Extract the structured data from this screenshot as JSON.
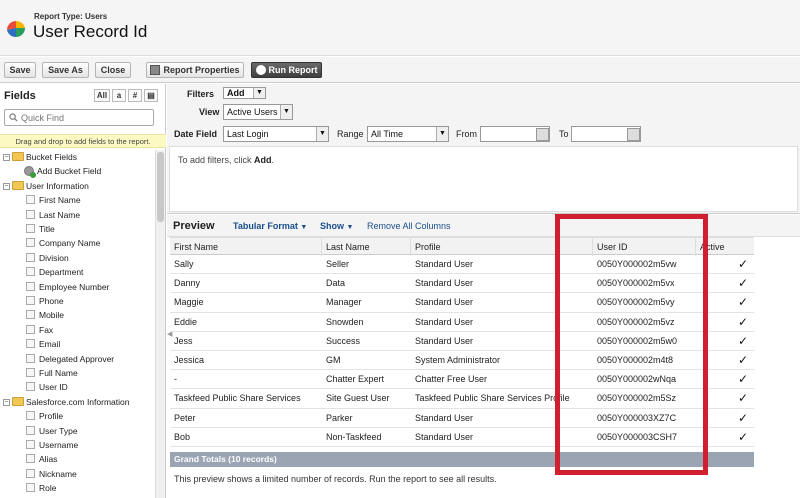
{
  "header": {
    "report_type": "Report Type: Users",
    "title": "User Record Id"
  },
  "toolbar": {
    "save": "Save",
    "save_as": "Save As",
    "close": "Close",
    "properties": "Report Properties",
    "run": "Run Report"
  },
  "fields_panel": {
    "heading": "Fields",
    "type_filters": [
      "All",
      "a",
      "#",
      "▤"
    ],
    "quick_find_placeholder": "Quick Find",
    "drag_note": "Drag and drop to add fields to the report.",
    "tree": [
      {
        "kind": "folder",
        "label": "Bucket Fields"
      },
      {
        "kind": "bucket",
        "label": "Add Bucket Field"
      },
      {
        "kind": "folder",
        "label": "User Information"
      },
      {
        "kind": "field",
        "label": "First Name"
      },
      {
        "kind": "field",
        "label": "Last Name"
      },
      {
        "kind": "field",
        "label": "Title"
      },
      {
        "kind": "field",
        "label": "Company Name"
      },
      {
        "kind": "field",
        "label": "Division"
      },
      {
        "kind": "field",
        "label": "Department"
      },
      {
        "kind": "field",
        "label": "Employee Number"
      },
      {
        "kind": "field",
        "label": "Phone"
      },
      {
        "kind": "field",
        "label": "Mobile"
      },
      {
        "kind": "field",
        "label": "Fax"
      },
      {
        "kind": "field",
        "label": "Email"
      },
      {
        "kind": "field",
        "label": "Delegated Approver"
      },
      {
        "kind": "field",
        "label": "Full Name"
      },
      {
        "kind": "field",
        "label": "User ID"
      },
      {
        "kind": "folder",
        "label": "Salesforce.com Information"
      },
      {
        "kind": "field",
        "label": "Profile"
      },
      {
        "kind": "field",
        "label": "User Type"
      },
      {
        "kind": "field",
        "label": "Username"
      },
      {
        "kind": "field",
        "label": "Alias"
      },
      {
        "kind": "field",
        "label": "Nickname"
      },
      {
        "kind": "field",
        "label": "Role"
      }
    ]
  },
  "filters": {
    "label": "Filters",
    "add": "Add",
    "view_label": "View",
    "view_value": "Active Users",
    "date_field_label": "Date Field",
    "date_field_value": "Last Login",
    "range_label": "Range",
    "range_value": "All Time",
    "from_label": "From",
    "to_label": "To",
    "hint_prefix": "To add filters, click ",
    "hint_bold": "Add",
    "hint_suffix": "."
  },
  "preview": {
    "title": "Preview",
    "format": "Tabular Format",
    "show": "Show",
    "remove_all": "Remove All Columns",
    "columns": [
      "First Name",
      "Last Name",
      "Profile",
      "User ID",
      "Active"
    ],
    "rows": [
      [
        "Sally",
        "Seller",
        "Standard User",
        "0050Y000002m5vw",
        "✓"
      ],
      [
        "Danny",
        "Data",
        "Standard User",
        "0050Y000002m5vx",
        "✓"
      ],
      [
        "Maggie",
        "Manager",
        "Standard User",
        "0050Y000002m5vy",
        "✓"
      ],
      [
        "Eddie",
        "Snowden",
        "Standard User",
        "0050Y000002m5vz",
        "✓"
      ],
      [
        "Jess",
        "Success",
        "Standard User",
        "0050Y000002m5w0",
        "✓"
      ],
      [
        "Jessica",
        "GM",
        "System Administrator",
        "0050Y000002m4t8",
        "✓"
      ],
      [
        "-",
        "Chatter Expert",
        "Chatter Free User",
        "0050Y000002wNqa",
        "✓"
      ],
      [
        "Taskfeed Public Share Services",
        "Site Guest User",
        "Taskfeed Public Share Services Profile",
        "0050Y000002m5Sz",
        "✓"
      ],
      [
        "Peter",
        "Parker",
        "Standard User",
        "0050Y000003XZ7C",
        "✓"
      ],
      [
        "Bob",
        "Non-Taskfeed",
        "Standard User",
        "0050Y000003CSH7",
        "✓"
      ]
    ],
    "totals": "Grand Totals (10 records)",
    "footnote": "This preview shows a limited number of records. Run the report to see all results."
  },
  "colors": {
    "highlight": "#d0202f",
    "link": "#1a4f8c",
    "totals_bg": "#9aa4b3"
  }
}
